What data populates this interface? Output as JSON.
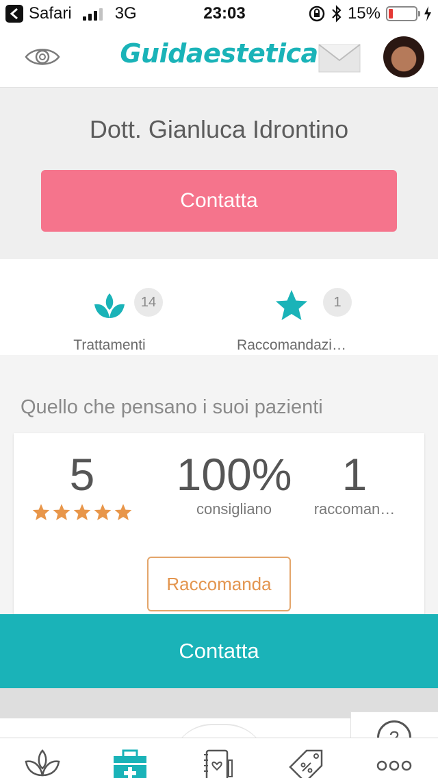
{
  "status_bar": {
    "carrier": "Safari",
    "network": "3G",
    "time": "23:03",
    "battery": "15%",
    "battery_level": 0.15
  },
  "navbar": {
    "title": "Guidaestetica"
  },
  "doctor": {
    "name": "Dott. Gianluca Idrontino",
    "contact_label": "Contatta"
  },
  "stats": [
    {
      "label": "Trattamenti",
      "count": "14",
      "icon": "lotus-icon"
    },
    {
      "label": "Raccomandazi…",
      "count": "1",
      "icon": "star-icon"
    }
  ],
  "reviews": {
    "title": "Quello che pensano i suoi pazienti",
    "rating": "5",
    "rating_stars": 5,
    "percent": "100%",
    "percent_label": "consigliano",
    "count": "1",
    "count_label": "raccoman…",
    "recommend_label": "Raccomanda"
  },
  "contact_bar": {
    "label": "Contatta"
  },
  "help": {
    "symbol": "?"
  },
  "tabbar": {
    "items": [
      {
        "icon": "lotus-outline-icon",
        "active": false
      },
      {
        "icon": "medical-kit-icon",
        "active": true
      },
      {
        "icon": "journal-heart-icon",
        "active": false
      },
      {
        "icon": "price-tag-icon",
        "active": false
      },
      {
        "icon": "more-dots-icon",
        "active": false
      }
    ]
  },
  "colors": {
    "teal": "#1ab3b8",
    "pink": "#f5748c",
    "orange": "#e3954f",
    "star": "#e8964a"
  }
}
